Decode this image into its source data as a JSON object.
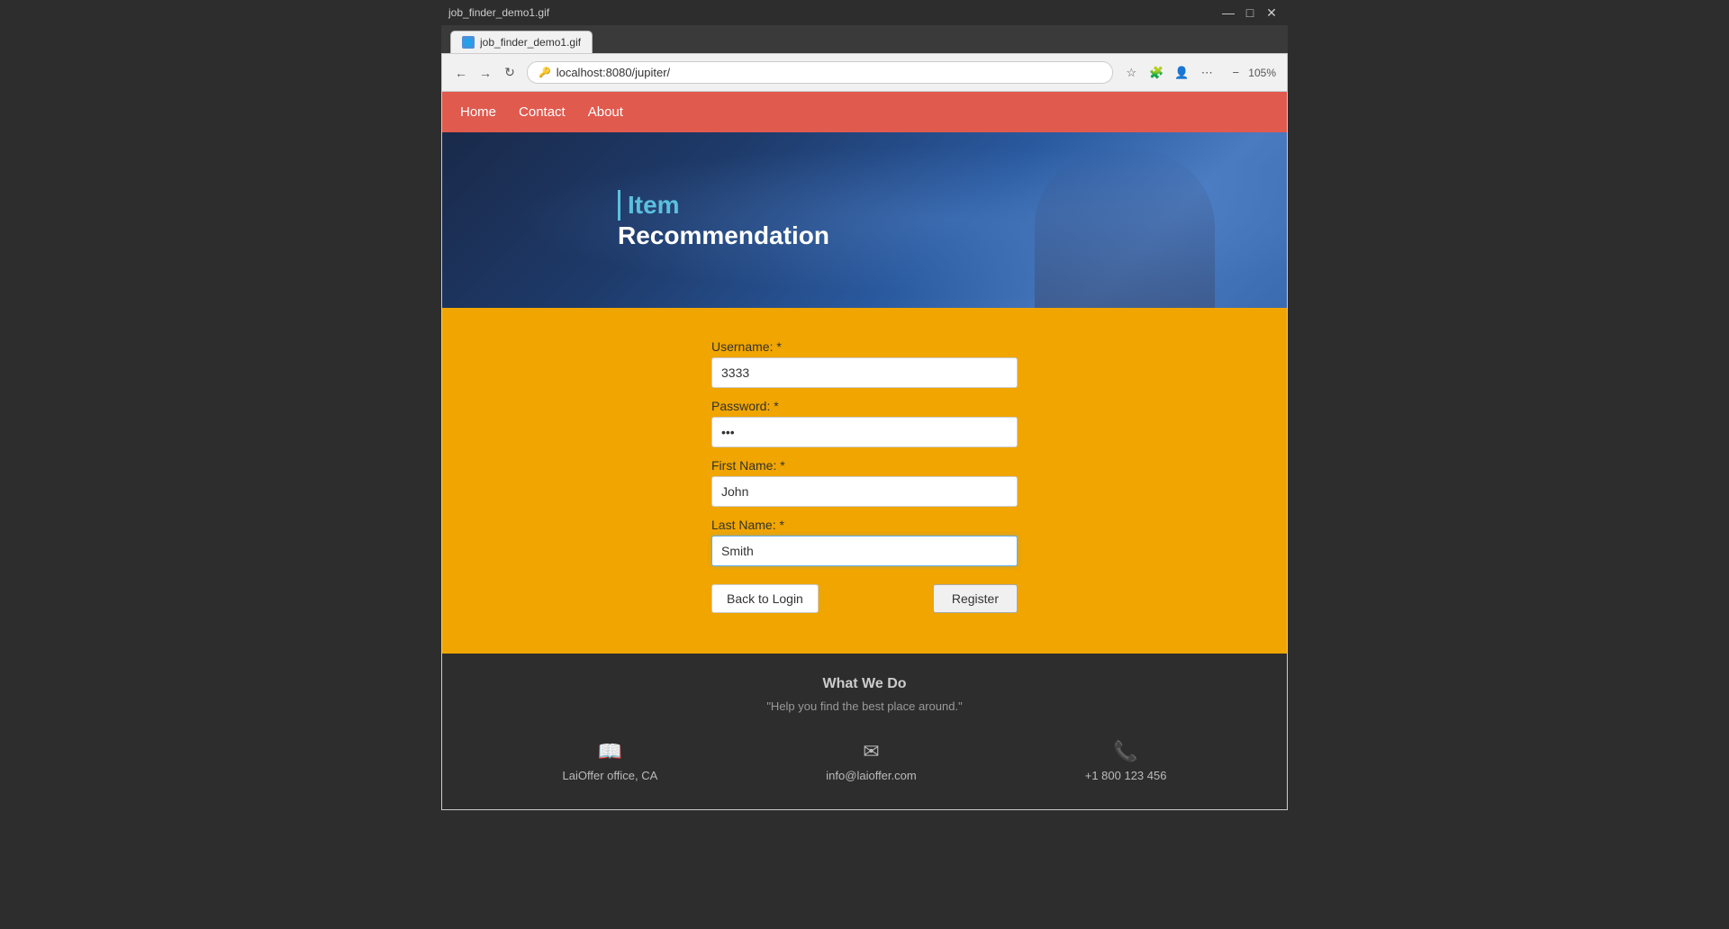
{
  "browser": {
    "tab_label": "job_finder_demo1.gif",
    "url": "localhost:8080/jupiter/",
    "zoom": "105%"
  },
  "nav": {
    "items": [
      {
        "label": "Home",
        "id": "home"
      },
      {
        "label": "Contact",
        "id": "contact"
      },
      {
        "label": "About",
        "id": "about"
      }
    ]
  },
  "hero": {
    "item_text": "Item",
    "recommendation_text": "Recommendation"
  },
  "register_form": {
    "username_label": "Username: *",
    "username_value": "3333",
    "password_label": "Password: *",
    "password_value": "•••",
    "first_name_label": "First Name: *",
    "first_name_value": "John",
    "last_name_label": "Last Name: *",
    "last_name_value": "Smith",
    "back_to_login_label": "Back to Login",
    "register_label": "Register"
  },
  "footer": {
    "what_we_do_title": "What We Do",
    "what_we_do_subtitle": "\"Help you find the best place around.\"",
    "office_label": "LaiOffer office, CA",
    "email_label": "info@laioffer.com",
    "phone_label": "+1 800 123 456"
  },
  "window_controls": {
    "minimize": "—",
    "maximize": "□",
    "close": "✕"
  }
}
